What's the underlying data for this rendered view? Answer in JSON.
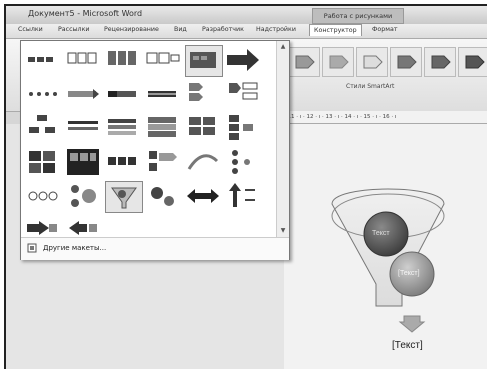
{
  "window": {
    "title": "Документ5 - Microsoft Word",
    "contextual_title": "Работа с рисунками SmartArt"
  },
  "tabs": [
    {
      "label": "Ссылки"
    },
    {
      "label": "Рассылки"
    },
    {
      "label": "Рецензирование"
    },
    {
      "label": "Вид"
    },
    {
      "label": "Разработчик"
    },
    {
      "label": "Надстройки"
    },
    {
      "label": "Конструктор"
    },
    {
      "label": "Формат"
    }
  ],
  "active_tab": "Конструктор",
  "ribbon": {
    "styles_group_label": "Стили SmartArt"
  },
  "ruler": {
    "text": "· 11 · ı · 12 · ı · 13 · ı · 14 · ı · 15 · ı · 16 · ı"
  },
  "layouts_gallery": {
    "more_layouts_label": "Другие макеты...",
    "rows": 6,
    "columns": 6,
    "selected_layout": "funnel"
  },
  "diagram": {
    "center_label": "Текст",
    "circle2_label": "[Текст]",
    "output_label": "[Текст]"
  },
  "colors": {
    "frame": "#d6d6d6",
    "page": "#f2f2f2",
    "accent_dark": "#3c3c3c"
  }
}
